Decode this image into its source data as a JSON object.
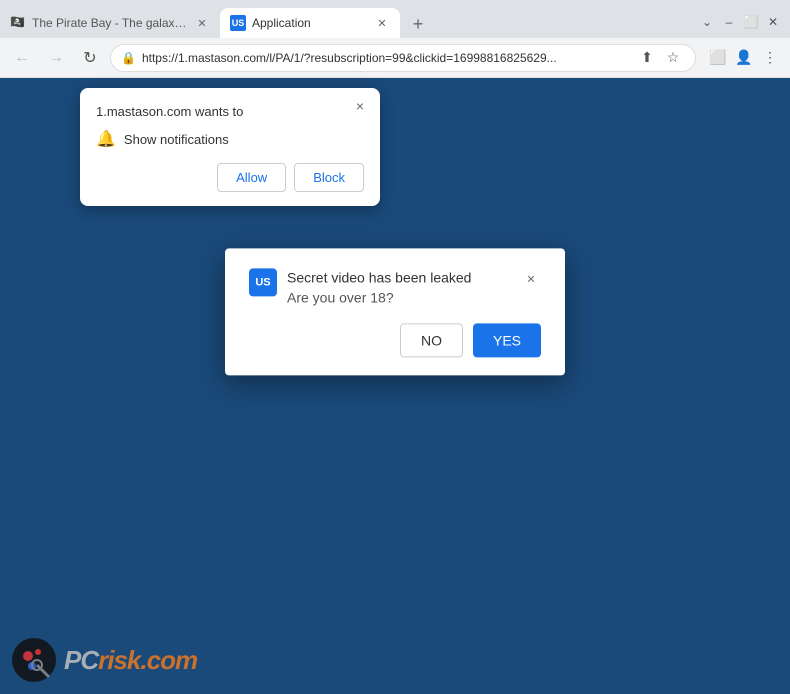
{
  "browser": {
    "tabs": [
      {
        "id": "tab1",
        "favicon": "🏴‍☠️",
        "title": "The Pirate Bay - The galaxy's mo...",
        "active": false,
        "closable": true
      },
      {
        "id": "tab2",
        "favicon": "US",
        "title": "Application",
        "active": true,
        "closable": true
      }
    ],
    "new_tab_label": "+",
    "window_controls": {
      "minimize": "–",
      "maximize": "⬜",
      "close": "✕"
    },
    "nav": {
      "back": "←",
      "forward": "→",
      "reload": "↻"
    },
    "url": "https://1.mastason.com/l/PA/1/?resubscription=99&clickid=16998816825629...",
    "url_actions": {
      "share": "⬆",
      "bookmark": "☆",
      "sidebar": "⬜",
      "profile": "👤",
      "menu": "⋮"
    }
  },
  "notification_popup": {
    "title": "1.mastason.com wants to",
    "permission_text": "Show notifications",
    "allow_label": "Allow",
    "block_label": "Block",
    "close_symbol": "×"
  },
  "age_dialog": {
    "favicon_text": "US",
    "title": "Secret video has been leaked",
    "subtitle": "Are you over 18?",
    "no_label": "NO",
    "yes_label": "YES",
    "close_symbol": "×"
  },
  "watermark": {
    "text_pc": "PC",
    "text_risk": "risk",
    "text_domain": ".com"
  }
}
